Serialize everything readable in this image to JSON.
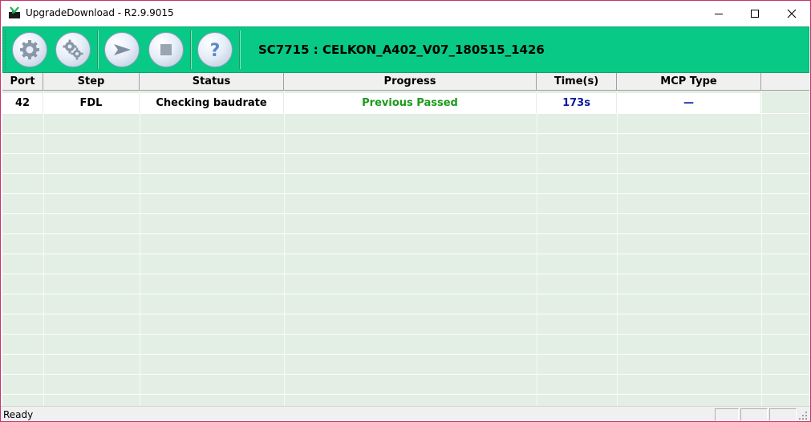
{
  "window": {
    "title": "UpgradeDownload - R2.9.9015"
  },
  "toolbar": {
    "buttons": [
      {
        "name": "settings-button",
        "icon": "gear-icon"
      },
      {
        "name": "multi-settings-button",
        "icon": "gears-icon"
      },
      {
        "name": "start-button",
        "icon": "play-arrow-icon"
      },
      {
        "name": "stop-button",
        "icon": "stop-square-icon"
      },
      {
        "name": "help-button",
        "icon": "question-mark-icon"
      }
    ],
    "project_label": "SC7715 : CELKON_A402_V07_180515_1426",
    "background_color": "#08c985"
  },
  "grid": {
    "columns": [
      "Port",
      "Step",
      "Status",
      "Progress",
      "Time(s)",
      "MCP Type"
    ],
    "rows": [
      {
        "port": "42",
        "step": "FDL",
        "status": "Checking baudrate",
        "progress": "Previous Passed",
        "time": "173s",
        "mcp_type": "—"
      }
    ],
    "progress_color": "#1a9a1a",
    "time_color": "#0a1aa0"
  },
  "statusbar": {
    "text": "Ready"
  }
}
